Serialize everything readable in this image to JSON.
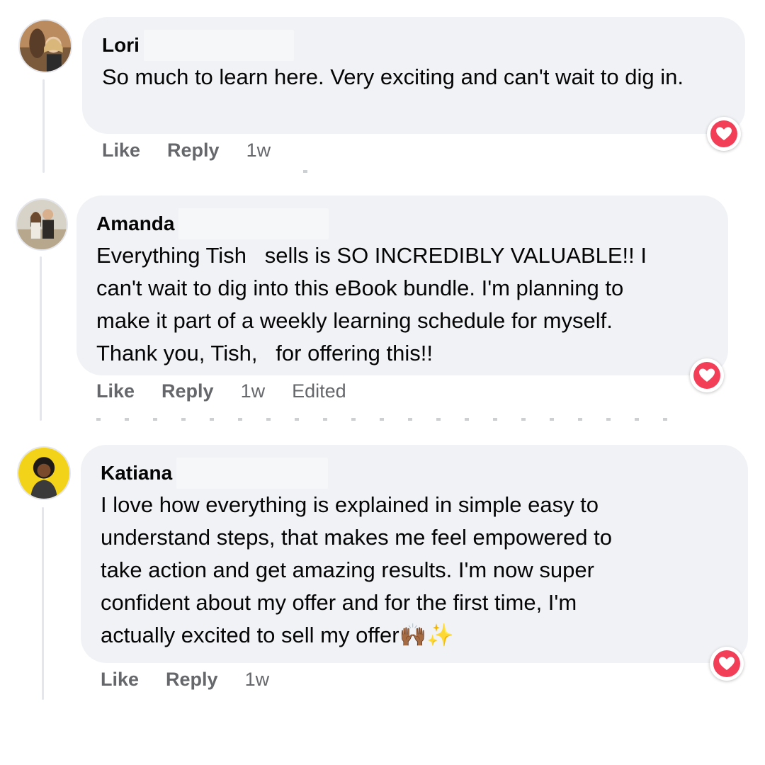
{
  "comments": [
    {
      "author": "Lori",
      "text": "So much to learn here. Very exciting and can't wait to dig in.",
      "actions": {
        "like": "Like",
        "reply": "Reply",
        "time": "1w"
      },
      "reaction": "love-icon"
    },
    {
      "author": "Amanda",
      "text_lines": [
        "Everything Tish   sells is SO INCREDIBLY VALUABLE!! I",
        "can't wait to dig into this eBook bundle. I'm planning to",
        "make it part of a weekly learning schedule for myself.",
        "Thank you, Tish,   for offering this!!"
      ],
      "actions": {
        "like": "Like",
        "reply": "Reply",
        "time": "1w",
        "edited": "Edited"
      },
      "reaction": "love-icon"
    },
    {
      "author": "Katiana",
      "text_lines": [
        "I love how everything is explained in simple easy to",
        "understand steps, that makes me feel empowered to",
        "take action and get amazing results. I'm now super",
        "confident about my offer and for the first time, I'm",
        "actually excited to sell my offer"
      ],
      "emoji": "🙌🏾✨",
      "actions": {
        "like": "Like",
        "reply": "Reply",
        "time": "1w"
      },
      "reaction": "love-icon"
    }
  ],
  "colors": {
    "bubble": "#f0f2f5",
    "meta_text": "#65676b",
    "love_red": "#f33e58"
  }
}
